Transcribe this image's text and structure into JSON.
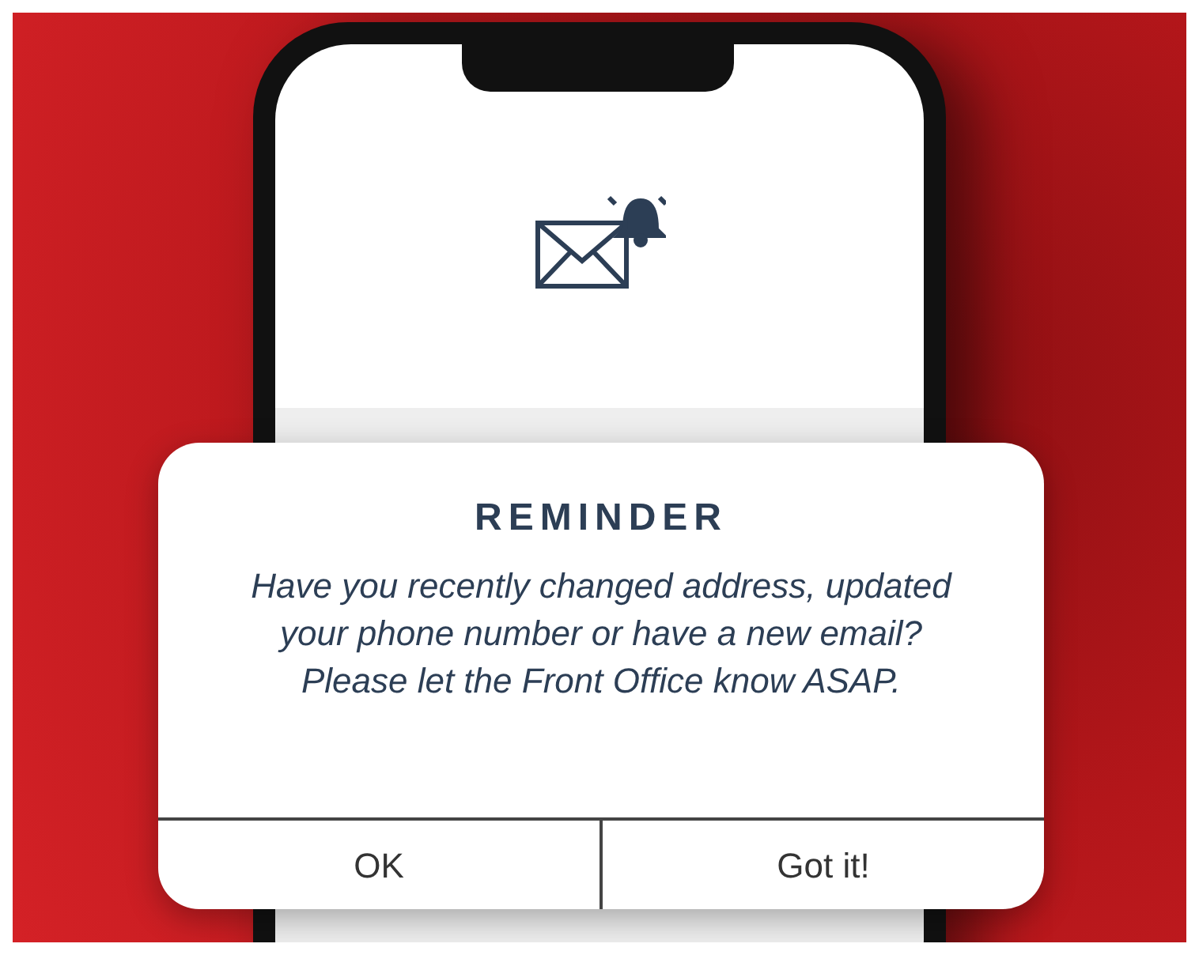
{
  "dialog": {
    "title": "REMINDER",
    "message": "Have you recently changed address, updated your phone number or have a new email? Please let the Front Office know ASAP.",
    "buttons": [
      {
        "label": "OK"
      },
      {
        "label": "Got it!"
      }
    ]
  }
}
